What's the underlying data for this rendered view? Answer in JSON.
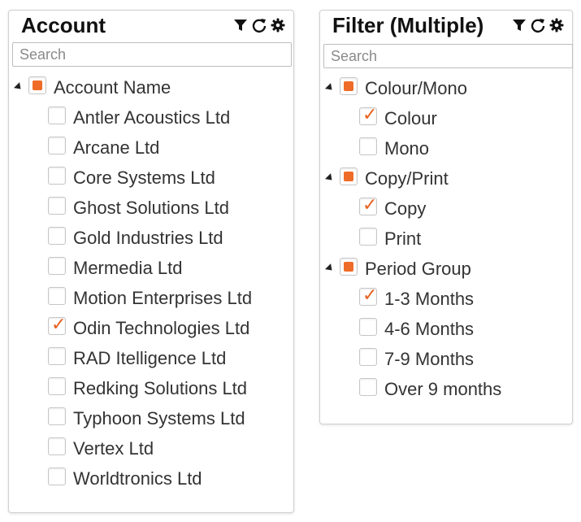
{
  "panels": {
    "account": {
      "title": "Account",
      "search_placeholder": "Search",
      "group": {
        "label": "Account Name",
        "state": "partial"
      },
      "items": [
        {
          "label": "Antler Acoustics Ltd",
          "checked": false
        },
        {
          "label": "Arcane Ltd",
          "checked": false
        },
        {
          "label": "Core Systems Ltd",
          "checked": false
        },
        {
          "label": "Ghost Solutions Ltd",
          "checked": false
        },
        {
          "label": "Gold Industries Ltd",
          "checked": false
        },
        {
          "label": "Mermedia Ltd",
          "checked": false
        },
        {
          "label": "Motion Enterprises Ltd",
          "checked": false
        },
        {
          "label": "Odin Technologies Ltd",
          "checked": true
        },
        {
          "label": "RAD Itelligence Ltd",
          "checked": false
        },
        {
          "label": "Redking Solutions Ltd",
          "checked": false
        },
        {
          "label": "Typhoon Systems Ltd",
          "checked": false
        },
        {
          "label": "Vertex Ltd",
          "checked": false
        },
        {
          "label": "Worldtronics Ltd",
          "checked": false
        }
      ]
    },
    "filter": {
      "title": "Filter (Multiple)",
      "search_placeholder": "Search",
      "groups": [
        {
          "label": "Colour/Mono",
          "state": "partial",
          "items": [
            {
              "label": "Colour",
              "checked": true
            },
            {
              "label": "Mono",
              "checked": false
            }
          ]
        },
        {
          "label": "Copy/Print",
          "state": "partial",
          "items": [
            {
              "label": "Copy",
              "checked": true
            },
            {
              "label": "Print",
              "checked": false
            }
          ]
        },
        {
          "label": "Period Group",
          "state": "partial",
          "items": [
            {
              "label": "1-3 Months",
              "checked": true
            },
            {
              "label": "4-6 Months",
              "checked": false
            },
            {
              "label": "7-9 Months",
              "checked": false
            },
            {
              "label": "Over 9 months",
              "checked": false
            }
          ]
        }
      ]
    }
  },
  "icons": [
    "filter-icon",
    "reset-icon",
    "settings-icon"
  ],
  "colors": {
    "accent": "#ef6c28",
    "check": "#e8601c",
    "border": "#d0d0d0"
  }
}
